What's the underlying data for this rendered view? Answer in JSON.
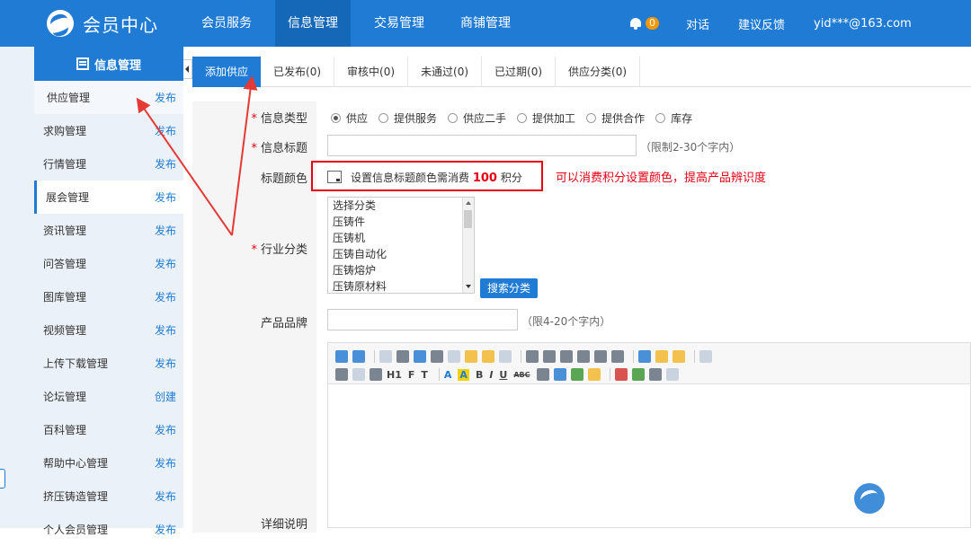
{
  "header": {
    "logo_text": "会员中心",
    "nav": [
      "会员服务",
      "信息管理",
      "交易管理",
      "商铺管理"
    ],
    "notification_count": "0",
    "links": [
      "对话",
      "建议反馈"
    ],
    "user": "yid***@163.com"
  },
  "sidebar": {
    "title": "信息管理",
    "items": [
      {
        "label": "供应管理",
        "action": "发布"
      },
      {
        "label": "求购管理",
        "action": "发布"
      },
      {
        "label": "行情管理",
        "action": "发布"
      },
      {
        "label": "展会管理",
        "action": "发布"
      },
      {
        "label": "资讯管理",
        "action": "发布"
      },
      {
        "label": "问答管理",
        "action": "发布"
      },
      {
        "label": "图库管理",
        "action": "发布"
      },
      {
        "label": "视频管理",
        "action": "发布"
      },
      {
        "label": "上传下载管理",
        "action": "发布"
      },
      {
        "label": "论坛管理",
        "action": "创建"
      },
      {
        "label": "百科管理",
        "action": "发布"
      },
      {
        "label": "帮助中心管理",
        "action": "发布"
      },
      {
        "label": "挤压铸造管理",
        "action": "发布"
      },
      {
        "label": "个人会员管理",
        "action": "发布"
      }
    ]
  },
  "tabs": [
    "添加供应",
    "已发布(0)",
    "审核中(0)",
    "未通过(0)",
    "已过期(0)",
    "供应分类(0)"
  ],
  "form": {
    "labels": {
      "info_type": "信息类型",
      "info_title": "信息标题",
      "title_color": "标题颜色",
      "industry": "行业分类",
      "brand": "产品品牌",
      "detail": "详细说明"
    },
    "required_mark": "*",
    "info_types": [
      "供应",
      "提供服务",
      "供应二手",
      "提供加工",
      "提供合作",
      "库存"
    ],
    "selected_type": "供应",
    "title_hint": "（限制2-30个字内）",
    "color_note_prefix": "设置信息标题颜色需消费",
    "color_cost": "100",
    "color_note_suffix": "积分",
    "color_annotation": "可以消费积分设置颜色，提高产品辨识度",
    "categories": [
      "选择分类",
      "压铸件",
      "压铸机",
      "压铸自动化",
      "压铸熔炉",
      "压铸原材料"
    ],
    "search_category_button": "搜索分类",
    "brand_hint": "（限4-20个字内）"
  },
  "editor": {
    "row2_text": [
      "H1",
      "F",
      "T",
      "A",
      "A",
      "B",
      "I",
      "U",
      "ABC"
    ]
  },
  "annotation_color": "#e60012",
  "accent": "#1f7bd4"
}
